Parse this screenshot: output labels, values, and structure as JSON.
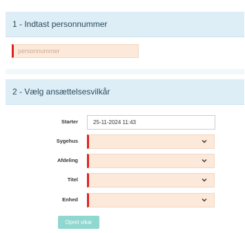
{
  "section1": {
    "title": "1 - Indtast personnummer",
    "cpr_placeholder": "personnummer"
  },
  "section2": {
    "title": "2 - Vælg ansættelsesvilkår",
    "starter_label": "Starter",
    "starter_value": "25-11-2024 11:43",
    "sygehus_label": "Sygehus",
    "sygehus_value": "",
    "afdeling_label": "Afdeling",
    "afdeling_value": "",
    "titel_label": "Titel",
    "titel_value": "",
    "enhed_label": "Enhed",
    "enhed_value": "",
    "submit_label": "Opret vikar"
  },
  "colors": {
    "header_bg": "#ddeef7",
    "invalid_field_bg": "#fde9d9",
    "invalid_marker": "#e02020",
    "button_bg": "#8fd7cf"
  },
  "icons": {
    "select_arrow": "chevron-down-icon"
  }
}
